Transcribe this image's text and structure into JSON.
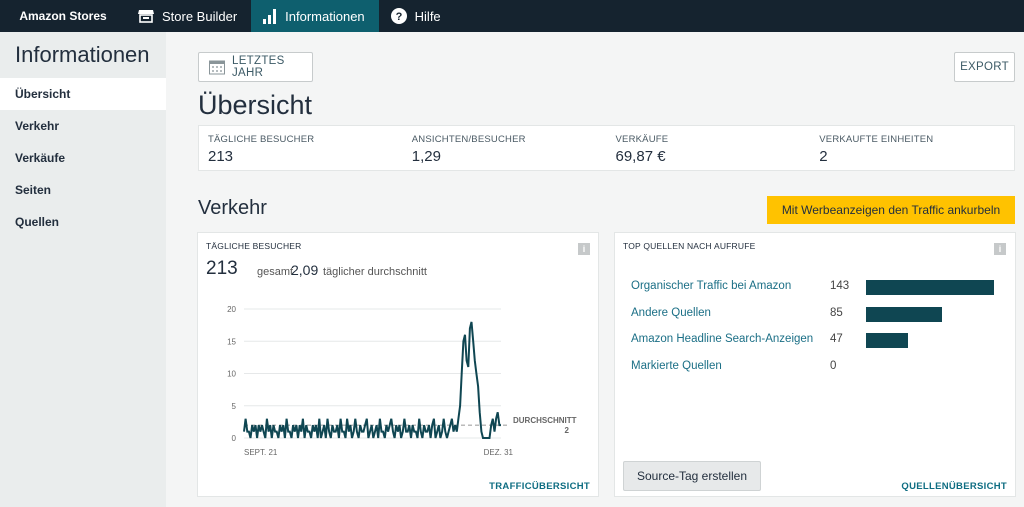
{
  "topnav": {
    "brand": "Amazon Stores",
    "items": [
      {
        "label": "Store Builder",
        "icon": "store-icon"
      },
      {
        "label": "Informationen",
        "icon": "bar-chart-icon",
        "active": true
      },
      {
        "label": "Hilfe",
        "icon": "help-icon"
      }
    ]
  },
  "sidebar": {
    "title": "Informationen",
    "items": [
      {
        "label": "Übersicht",
        "active": true
      },
      {
        "label": "Verkehr"
      },
      {
        "label": "Verkäufe"
      },
      {
        "label": "Seiten"
      },
      {
        "label": "Quellen"
      }
    ]
  },
  "header": {
    "date_filter": "LETZTES JAHR",
    "export": "EXPORT",
    "title": "Übersicht"
  },
  "kpis": [
    {
      "label": "TÄGLICHE BESUCHER",
      "value": "213"
    },
    {
      "label": "ANSICHTEN/BESUCHER",
      "value": "1,29"
    },
    {
      "label": "VERKÄUFE",
      "value": "69,87 €"
    },
    {
      "label": "VERKAUFTE EINHEITEN",
      "value": "2"
    }
  ],
  "traffic": {
    "section_title": "Verkehr",
    "cta": "Mit Werbeanzeigen den Traffic ankurbeln",
    "visitors_card": {
      "title": "TÄGLICHE BESUCHER",
      "total": "213",
      "total_label": "gesamt",
      "avg": "2,09",
      "avg_label": "täglicher durchschnitt",
      "avg_line_label": "DURCHSCHNITT",
      "avg_line_value": "2",
      "footer_link": "TRAFFICÜBERSICHT"
    },
    "sources_card": {
      "title": "TOP QUELLEN NACH AUFRUFE",
      "rows": [
        {
          "name": "Organischer Traffic bei Amazon",
          "value": 143
        },
        {
          "name": "Andere Quellen",
          "value": 85
        },
        {
          "name": "Amazon Headline Search-Anzeigen",
          "value": 47
        },
        {
          "name": "Markierte Quellen",
          "value": 0
        }
      ],
      "button": "Source-Tag erstellen",
      "footer_link": "QUELLENÜBERSICHT"
    }
  },
  "chart_data": {
    "type": "line",
    "title": "TÄGLICHE BESUCHER",
    "x_tick_labels": [
      "SEPT. 21",
      "DEZ. 31"
    ],
    "y_ticks": [
      0,
      5,
      10,
      15,
      20
    ],
    "ylim": [
      0,
      20
    ],
    "average": 2,
    "grid": true,
    "series": [
      {
        "values": [
          1,
          3,
          1,
          1,
          0,
          2,
          1,
          2,
          0,
          2,
          1,
          2,
          1,
          0,
          3,
          1,
          2,
          0,
          2,
          1,
          1,
          0,
          2,
          1,
          2,
          0,
          3,
          1,
          1,
          0,
          2,
          1,
          2,
          0,
          2,
          1,
          3,
          0,
          2,
          1,
          1,
          0,
          2,
          1,
          2,
          0,
          3,
          0,
          1,
          2,
          0,
          3,
          1,
          0,
          2,
          1,
          1,
          2,
          0,
          3,
          1,
          1,
          0,
          3,
          1,
          2,
          0,
          1,
          3,
          1,
          0,
          2,
          1,
          1,
          2,
          3,
          0,
          1,
          2,
          0,
          1,
          2,
          0,
          3,
          1,
          1,
          0,
          2,
          1,
          2,
          3,
          1,
          0,
          2,
          1,
          2,
          0,
          1,
          3,
          1,
          1,
          2,
          0,
          2,
          1,
          1,
          0,
          3,
          1,
          0,
          2,
          1,
          1,
          2,
          0,
          2,
          3,
          0,
          1,
          2,
          0,
          1,
          3,
          1,
          0,
          1,
          2,
          3,
          1,
          2,
          1,
          3,
          5,
          10,
          15,
          16,
          12,
          11,
          17,
          18,
          15,
          12,
          10,
          8,
          4,
          1,
          0,
          0,
          0,
          0,
          0,
          2,
          3,
          1,
          3,
          4,
          2,
          2
        ]
      }
    ]
  },
  "colors": {
    "topnav_bg": "#15232f",
    "active_nav_bg": "#0e5f6e",
    "cta_bg": "#ffc200",
    "chart_line": "#0f4652",
    "source_bar": "#0f4652",
    "link": "#0e6d82"
  }
}
